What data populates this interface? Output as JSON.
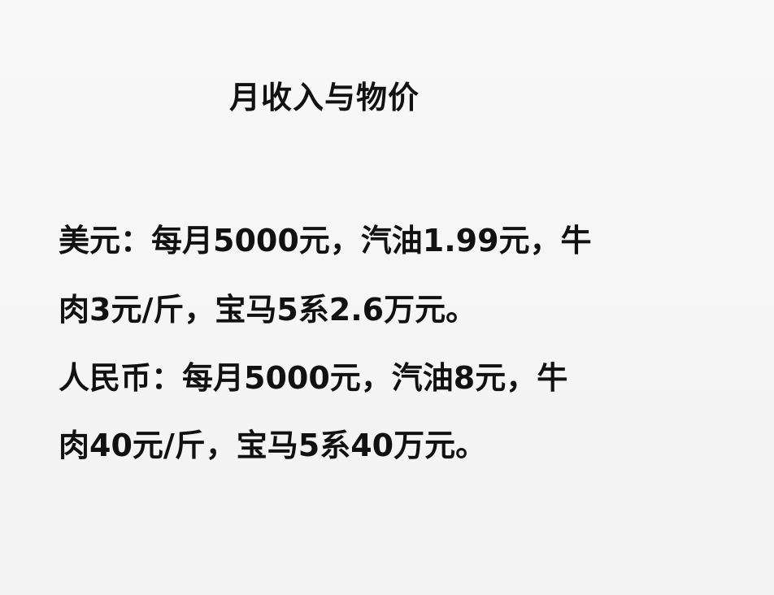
{
  "document": {
    "title": "月收入与物价",
    "lines": [
      "美元：每月5000元，汽油1.99元，牛",
      "肉3元/斤，宝马5系2.6万元。",
      "人民币：每月5000元，汽油8元，牛",
      "肉40元/斤，宝马5系40万元。"
    ]
  }
}
